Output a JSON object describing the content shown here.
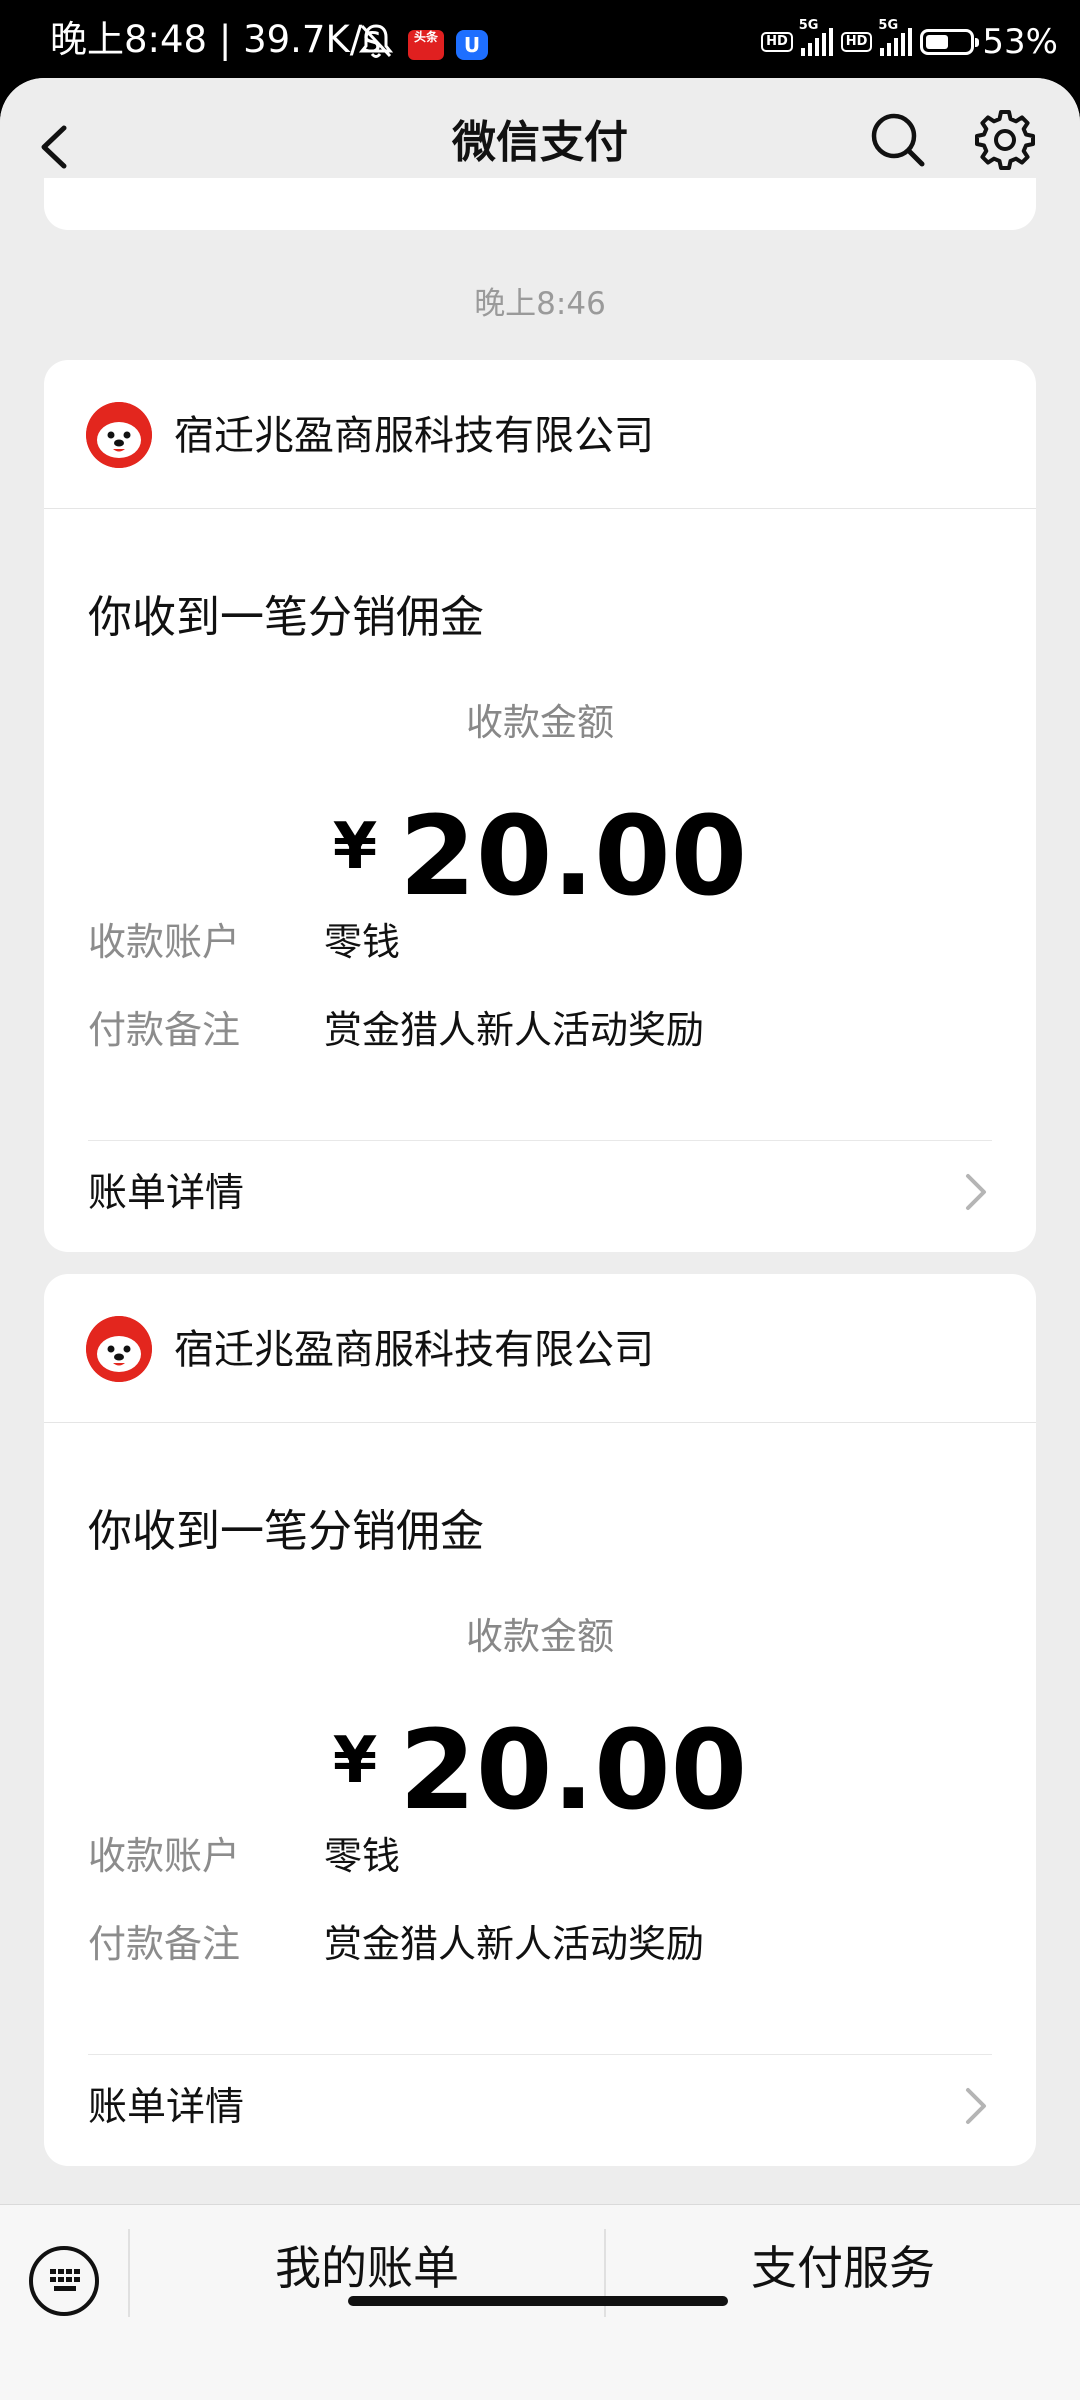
{
  "status_bar": {
    "time": "晚上8:48",
    "speed": "39.7K/s",
    "app_badge_1": "头条",
    "app_badge_2": "U",
    "hd1": "HD",
    "net1": "5G",
    "hd2": "HD",
    "net2": "5G",
    "battery_pct_label": "53%",
    "battery_level": 0.53
  },
  "navbar": {
    "title": "微信支付"
  },
  "timestamp": "晚上8:46",
  "cards": [
    {
      "merchant": "宿迁兆盈商服科技有限公司",
      "title": "你收到一笔分销佣金",
      "amount_label": "收款金额",
      "currency": "¥",
      "amount": "20.00",
      "account_key": "收款账户",
      "account_value": "零钱",
      "memo_key": "付款备注",
      "memo_value": "赏金猎人新人活动奖励",
      "detail_label": "账单详情"
    },
    {
      "merchant": "宿迁兆盈商服科技有限公司",
      "title": "你收到一笔分销佣金",
      "amount_label": "收款金额",
      "currency": "¥",
      "amount": "20.00",
      "account_key": "收款账户",
      "account_value": "零钱",
      "memo_key": "付款备注",
      "memo_value": "赏金猎人新人活动奖励",
      "detail_label": "账单详情"
    }
  ],
  "bottom_bar": {
    "my_bills": "我的账单",
    "pay_services": "支付服务"
  },
  "icons": {
    "back": "back-arrow-icon",
    "search": "search-icon",
    "settings": "gear-icon",
    "keyboard": "keyboard-icon",
    "chevron": "chevron-right-icon"
  }
}
